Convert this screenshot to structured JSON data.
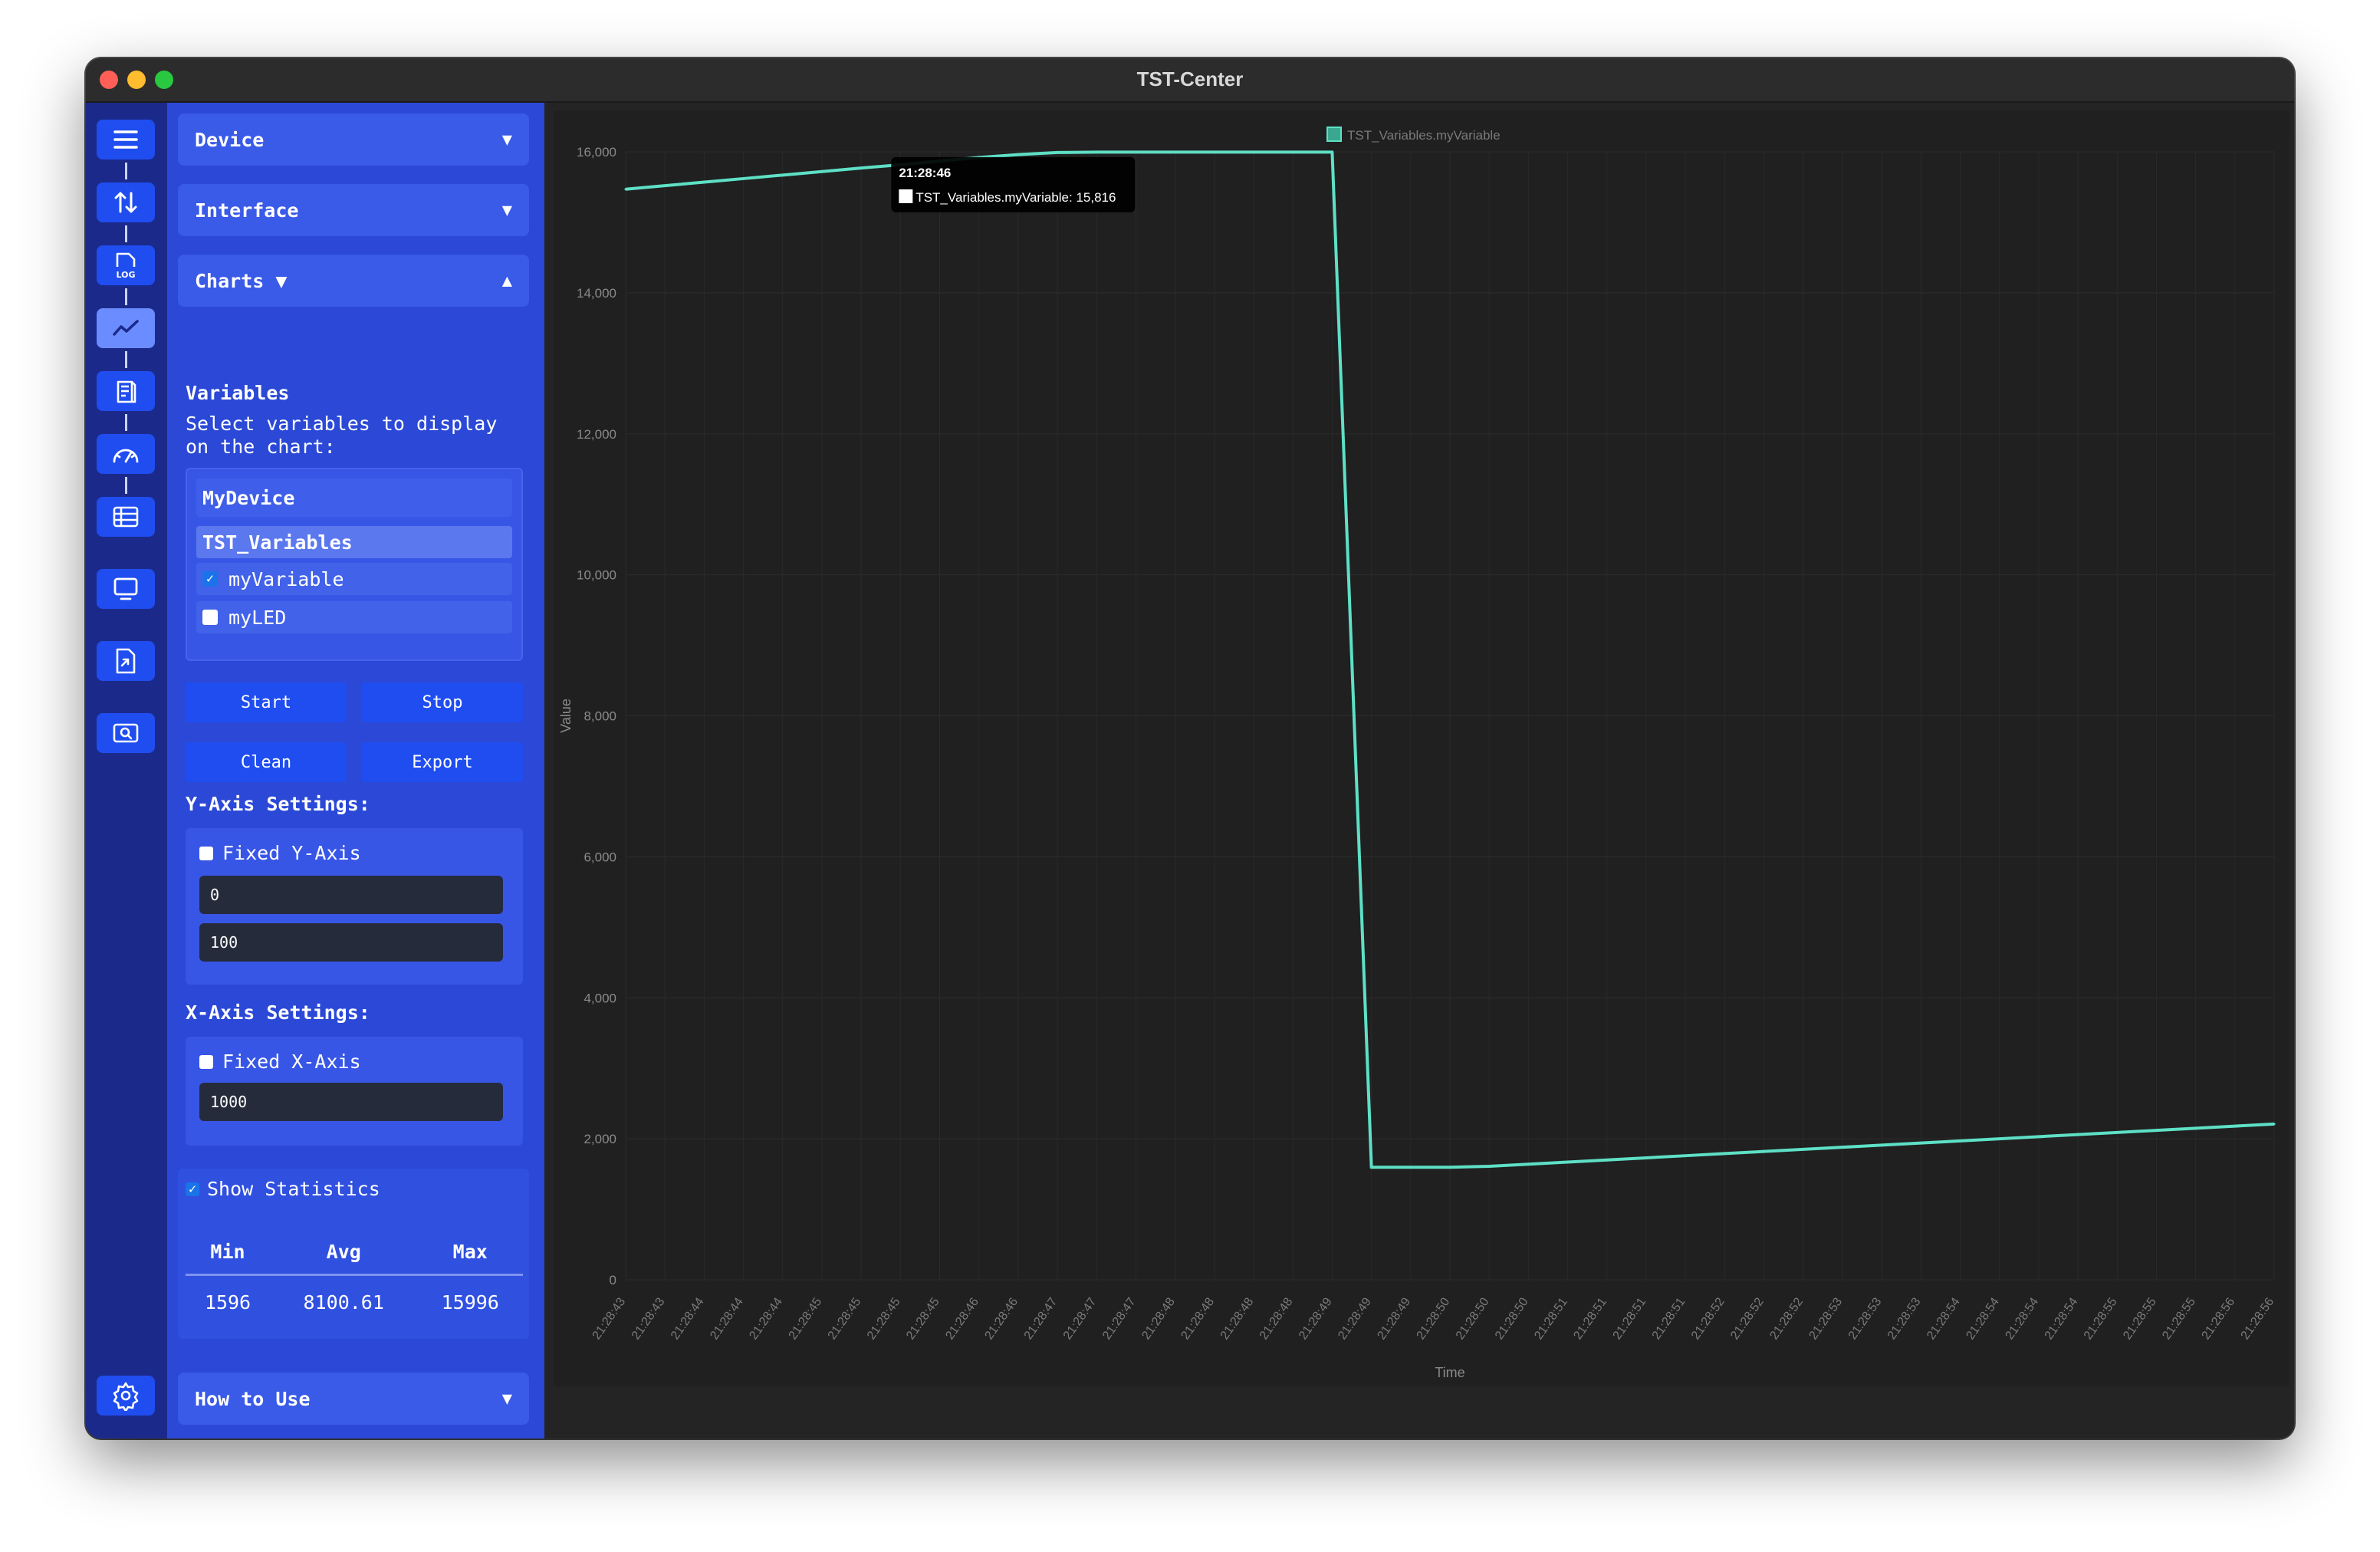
{
  "window": {
    "title": "TST-Center"
  },
  "rail": {
    "icons": [
      "menu-icon",
      "transfer-icon",
      "log-icon",
      "chart-icon",
      "document-icon",
      "gauge-icon",
      "table-icon",
      "monitor-icon",
      "file-export-icon",
      "screenshot-icon",
      "gear-icon"
    ],
    "log_badge": "LOG"
  },
  "panel": {
    "device_label": "Device",
    "interface_label": "Interface",
    "charts_label": "Charts ▼",
    "arrow_down": "▼",
    "arrow_up": "▲",
    "variables_title": "Variables",
    "variables_hint": "Select variables to display on the chart:",
    "tree": {
      "device": "MyDevice",
      "group": "TST_Variables",
      "items": [
        {
          "label": "myVariable",
          "checked": true
        },
        {
          "label": "myLED",
          "checked": false
        }
      ]
    },
    "buttons": {
      "start": "Start",
      "stop": "Stop",
      "clean": "Clean",
      "export": "Export"
    },
    "y_axis": {
      "title": "Y-Axis Settings:",
      "fixed_label": "Fixed Y-Axis",
      "fixed": false,
      "min_value": "0",
      "max_value": "100"
    },
    "x_axis": {
      "title": "X-Axis Settings:",
      "fixed_label": "Fixed X-Axis",
      "fixed": false,
      "window_value": "1000"
    },
    "statistics": {
      "label": "Show Statistics",
      "enabled": true,
      "headers": [
        "Min",
        "Avg",
        "Max"
      ],
      "values": [
        "1596",
        "8100.61",
        "15996"
      ]
    },
    "how_to_use_label": "How to Use"
  },
  "colors": {
    "accent": "#1f4df0",
    "panel": "#2b49d6",
    "rail": "#1b2a8a",
    "series": "#5ee0c6",
    "chart_bg": "#202020"
  },
  "chart_data": {
    "type": "line",
    "xlabel": "Time",
    "ylabel": "Value",
    "ylim": [
      0,
      16000
    ],
    "yticks": [
      "0",
      "2,000",
      "4,000",
      "6,000",
      "8,000",
      "10,000",
      "12,000",
      "14,000",
      "16,000"
    ],
    "ytick_values": [
      0,
      2000,
      4000,
      6000,
      8000,
      10000,
      12000,
      14000,
      16000
    ],
    "x": [
      "21:28:43",
      "21:28:43",
      "21:28:44",
      "21:28:44",
      "21:28:44",
      "21:28:45",
      "21:28:45",
      "21:28:45",
      "21:28:45",
      "21:28:46",
      "21:28:46",
      "21:28:47",
      "21:28:47",
      "21:28:47",
      "21:28:48",
      "21:28:48",
      "21:28:48",
      "21:28:48",
      "21:28:49",
      "21:28:49",
      "21:28:49",
      "21:28:50",
      "21:28:50",
      "21:28:50",
      "21:28:51",
      "21:28:51",
      "21:28:51",
      "21:28:51",
      "21:28:52",
      "21:28:52",
      "21:28:52",
      "21:28:53",
      "21:28:53",
      "21:28:53",
      "21:28:54",
      "21:28:54",
      "21:28:54",
      "21:28:54",
      "21:28:55",
      "21:28:55",
      "21:28:55",
      "21:28:56",
      "21:28:56"
    ],
    "legend": "top-center",
    "series": [
      {
        "name": "TST_Variables.myVariable",
        "values": [
          15470,
          15520,
          15570,
          15620,
          15670,
          15720,
          15770,
          15816,
          15870,
          15920,
          15960,
          15990,
          15996,
          15996,
          15996,
          15996,
          15996,
          15996,
          15996,
          1596,
          1596,
          1596,
          1610,
          1640,
          1670,
          1700,
          1730,
          1760,
          1790,
          1820,
          1850,
          1880,
          1910,
          1940,
          1970,
          2000,
          2030,
          2060,
          2090,
          2120,
          2150,
          2180,
          2210
        ]
      }
    ],
    "tooltip": {
      "time": "21:28:46",
      "text": "TST_Variables.myVariable: 15,816"
    }
  }
}
